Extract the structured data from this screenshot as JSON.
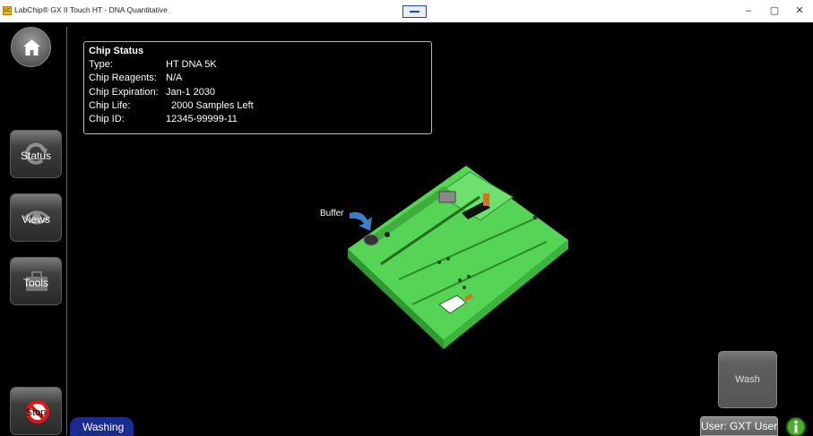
{
  "window": {
    "title": "LabChip® GX II Touch HT - DNA Quantitative",
    "app_icon_text": "LC",
    "minimize": "–",
    "maximize": "▢",
    "close": "✕"
  },
  "sidebar": {
    "home_icon": "home-icon",
    "items": [
      {
        "label": "Status",
        "icon": "refresh-icon"
      },
      {
        "label": "Views",
        "icon": "eye-icon"
      },
      {
        "label": "Tools",
        "icon": "toolbox-icon"
      }
    ],
    "stop_label": "Stop"
  },
  "chip_status": {
    "header": "Chip Status",
    "rows": [
      {
        "key": "Type:",
        "value": "HT DNA 5K"
      },
      {
        "key": "Chip Reagents:",
        "value": "N/A"
      },
      {
        "key": "Chip Expiration:",
        "value": "Jan-1 2030"
      },
      {
        "key": "Chip Life:",
        "value": "2000 Samples Left"
      },
      {
        "key": "Chip ID:",
        "value": "12345-99999-11"
      }
    ]
  },
  "chip_view": {
    "buffer_label": "Buffer",
    "chip_color": "#55d455",
    "arrow_color": "#3a7fc8"
  },
  "footer": {
    "status_text": "Washing",
    "wash_label": "Wash",
    "user_label": "User: GXT User",
    "info_icon": "info-icon"
  },
  "colors": {
    "status_pill": "#1a2b8f",
    "info_green": "#4caf28",
    "stop_red": "#e01515"
  }
}
